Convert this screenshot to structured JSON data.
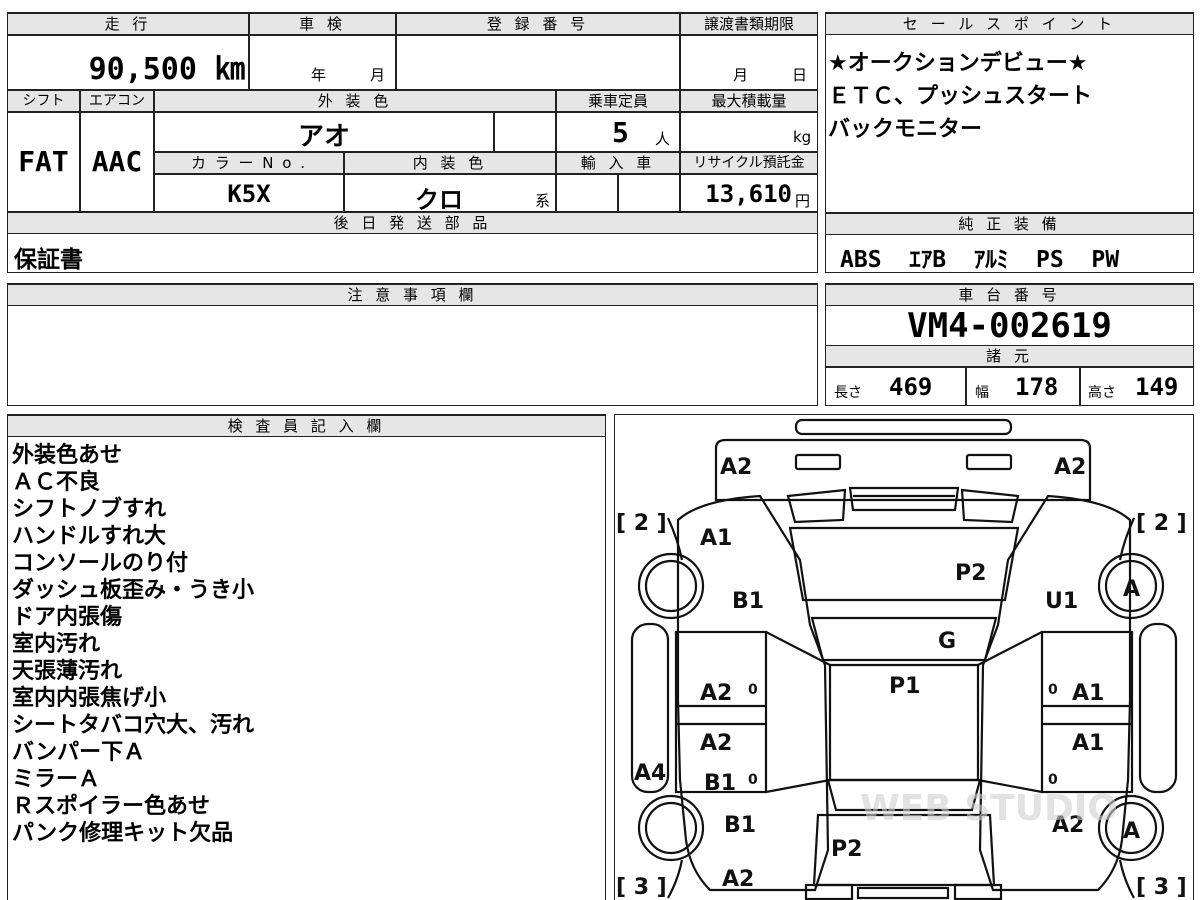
{
  "top_main": {
    "mileage_header": "走 行",
    "mileage_value": "90,500 ㎞",
    "inspection_header": "車 検",
    "inspection_year_unit": "年",
    "inspection_month_unit": "月",
    "registration_header": "登 録 番 号",
    "transfer_deadline_header": "譲渡書類期限",
    "transfer_month_unit": "月",
    "transfer_day_unit": "日",
    "shift_header": "シフト",
    "aircon_header": "エアコン",
    "exterior_color_header": "外 装 色",
    "capacity_header": "乗車定員",
    "max_load_header": "最大積載量",
    "shift_value": "FAT",
    "aircon_value": "AAC",
    "exterior_color_value": "アオ",
    "capacity_value": "5",
    "capacity_unit": "人",
    "max_load_unit": "kg",
    "color_no_header": "カ ラ ー N o .",
    "interior_color_header": "内 装 色",
    "import_header": "輸 入 車",
    "recycle_header": "リサイクル預託金",
    "color_no_value": "K5X",
    "interior_color_value": "クロ",
    "interior_color_suffix": "系",
    "recycle_value": "13,610",
    "recycle_unit": "円",
    "later_parts_header": "後 日 発 送 部 品",
    "later_parts_value": "保証書"
  },
  "sales_point": {
    "header": "セ ー ル ス ポ イ ン ト",
    "lines": [
      "★オークションデビュー★",
      "ＥＴＣ、プッシュスタート",
      "バックモニター"
    ]
  },
  "equipment": {
    "header": "純 正 装 備",
    "value": "ABS  ｴｱB  ｱﾙﾐ  PS  PW"
  },
  "notes": {
    "header": "注 意 事 項 欄"
  },
  "chassis": {
    "header": "車 台 番 号",
    "value": "VM4-002619"
  },
  "specs": {
    "header": "諸 元",
    "length_label": "長さ",
    "length_value": "469",
    "width_label": "幅",
    "width_value": "178",
    "height_label": "高さ",
    "height_value": "149"
  },
  "inspector": {
    "header": "検 査 員 記 入 欄",
    "items": [
      "外装色あせ",
      "ＡＣ不良",
      "シフトノブすれ",
      "ハンドルすれ大",
      "コンソールのり付",
      "ダッシュ板歪み・うき小",
      "ドア内張傷",
      "室内汚れ",
      "天張薄汚れ",
      "室内内張焦げ小",
      "シートタバコ穴大、汚れ",
      "バンパー下Ａ",
      "ミラーＡ",
      "Ｒスポイラー色あせ",
      "パンク修理キット欠品"
    ]
  },
  "diagram": {
    "labels": {
      "front_left": "A2",
      "front_right": "A2",
      "left_top_bracket": "[ 2 ]",
      "right_top_bracket": "[ 2 ]",
      "left_bottom_bracket": "[ 3 ]",
      "right_bottom_bracket": "[ 3 ]",
      "a1_front_left": "A1",
      "b1_front_left": "B1",
      "p2_hood": "P2",
      "u1_front_right": "U1",
      "tire_fr": "A",
      "g_windshield": "G",
      "p1_roof": "P1",
      "a2_door_fl": "A2",
      "a1_door_fr": "A1",
      "a2_door_rl": "A2",
      "b1_door_rl": "B1",
      "a1_door_rr": "A1",
      "a4_side": "A4",
      "b1_rear_left": "B1",
      "p2_trunk": "P2",
      "a2_rear_right": "A2",
      "tire_rr": "A",
      "a2_rear_bottom": "A2",
      "zero_1": "0",
      "zero_2": "0",
      "zero_3": "0",
      "zero_4": "0",
      "watermark": "WEB STUDIO"
    }
  }
}
